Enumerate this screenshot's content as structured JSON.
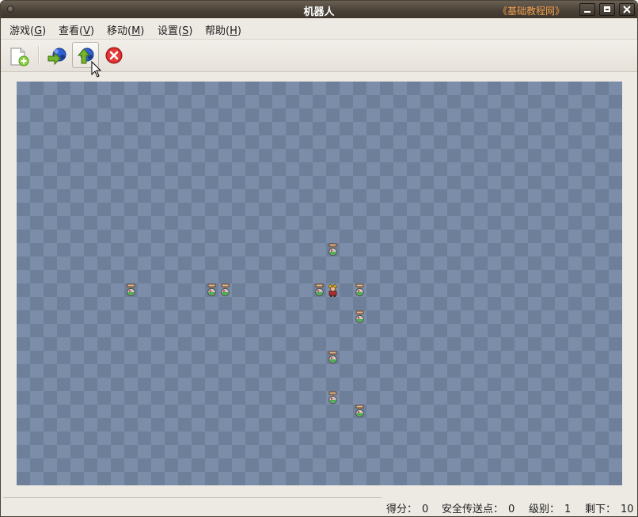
{
  "window": {
    "title": "机器人",
    "title_link": "《基础教程网》"
  },
  "menu": [
    {
      "label": "游戏(",
      "mnemonic": "G",
      "close": ")"
    },
    {
      "label": "查看(",
      "mnemonic": "V",
      "close": ")"
    },
    {
      "label": "移动(",
      "mnemonic": "M",
      "close": ")"
    },
    {
      "label": "设置(",
      "mnemonic": "S",
      "close": ")"
    },
    {
      "label": "帮助(",
      "mnemonic": "H",
      "close": ")"
    }
  ],
  "toolbar": {
    "buttons": [
      {
        "name": "new-game",
        "icon": "new-document-icon"
      },
      {
        "name": "teleport",
        "icon": "teleport-icon"
      },
      {
        "name": "safe-teleport",
        "icon": "safe-teleport-icon"
      },
      {
        "name": "wait",
        "icon": "stop-icon"
      }
    ]
  },
  "board": {
    "cols": 45,
    "rows": 30,
    "player": [
      23,
      15
    ],
    "robots": [
      [
        23,
        12
      ],
      [
        8,
        15
      ],
      [
        14,
        15
      ],
      [
        15,
        15
      ],
      [
        22,
        15
      ],
      [
        25,
        15
      ],
      [
        25,
        17
      ],
      [
        23,
        20
      ],
      [
        23,
        23
      ],
      [
        25,
        24
      ]
    ]
  },
  "status": {
    "score_label": "得分：",
    "score": "0",
    "safe_label": "安全传送点：",
    "safe": "0",
    "level_label": "级别：",
    "level": "1",
    "remaining_label": "剩下：",
    "remaining": "10"
  }
}
